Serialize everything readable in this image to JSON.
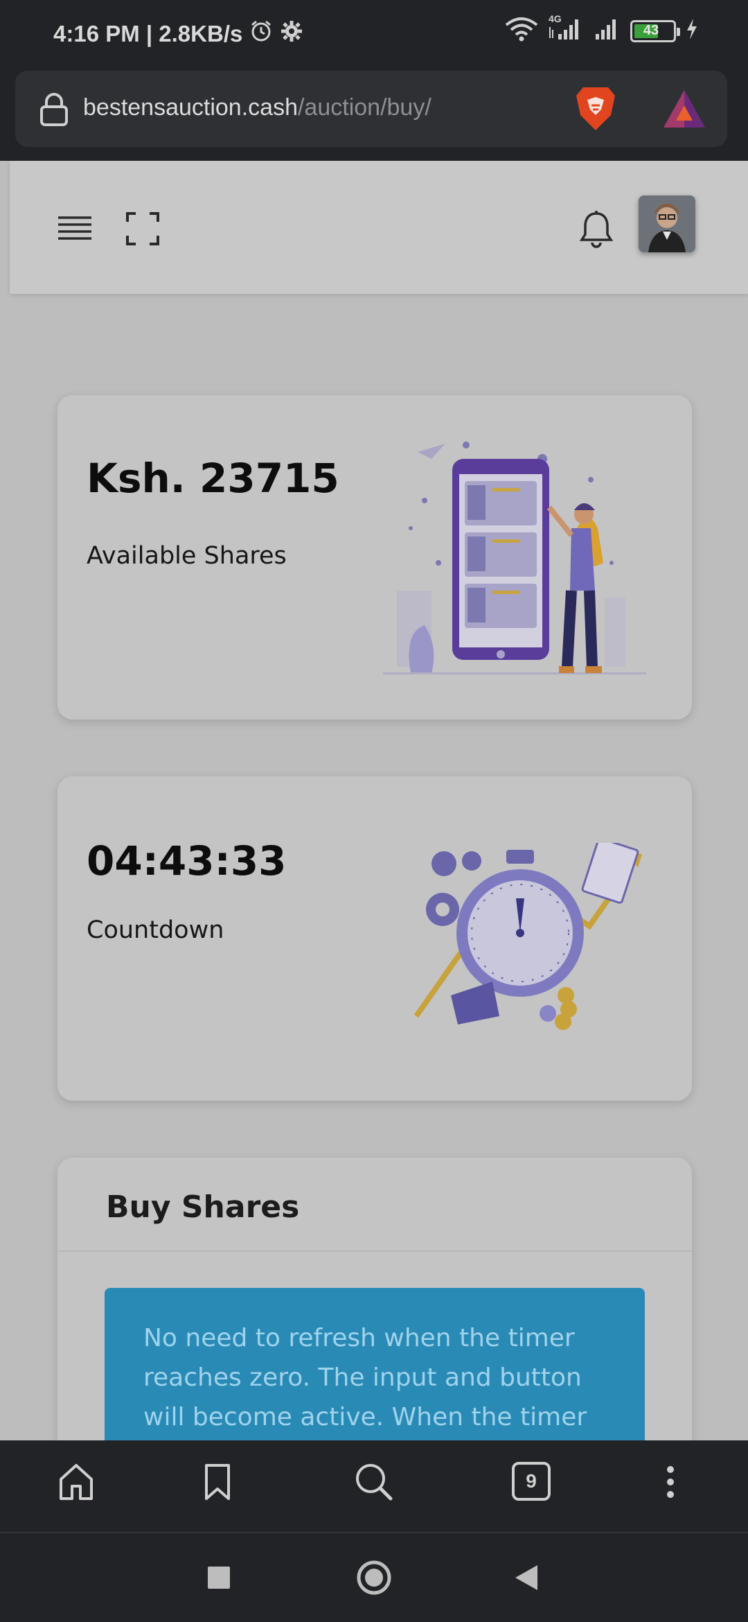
{
  "status_bar": {
    "time_and_speed": "4:16 PM | 2.8KB/s",
    "network_type": "4G",
    "battery_level": "43"
  },
  "browser": {
    "url_domain": "bestensauction.cash",
    "url_path": "/auction/buy/"
  },
  "cards": {
    "shares": {
      "value": "Ksh. 23715",
      "label": "Available Shares"
    },
    "countdown": {
      "value": "04:43:33",
      "label": "Countdown"
    }
  },
  "buy_shares": {
    "title": "Buy Shares",
    "alert_text": "No need to refresh when the timer reaches zero. The input and button will become active. When the timer"
  },
  "toolbar": {
    "tabs_count": "9"
  },
  "icons": [
    "lock-icon",
    "brave-icon",
    "bat-icon",
    "menu-icon",
    "expand-icon",
    "bell-icon",
    "home-icon",
    "bookmark-icon",
    "search-icon",
    "tabs-icon",
    "more-icon",
    "recents-icon",
    "home-circle-icon",
    "back-icon"
  ]
}
